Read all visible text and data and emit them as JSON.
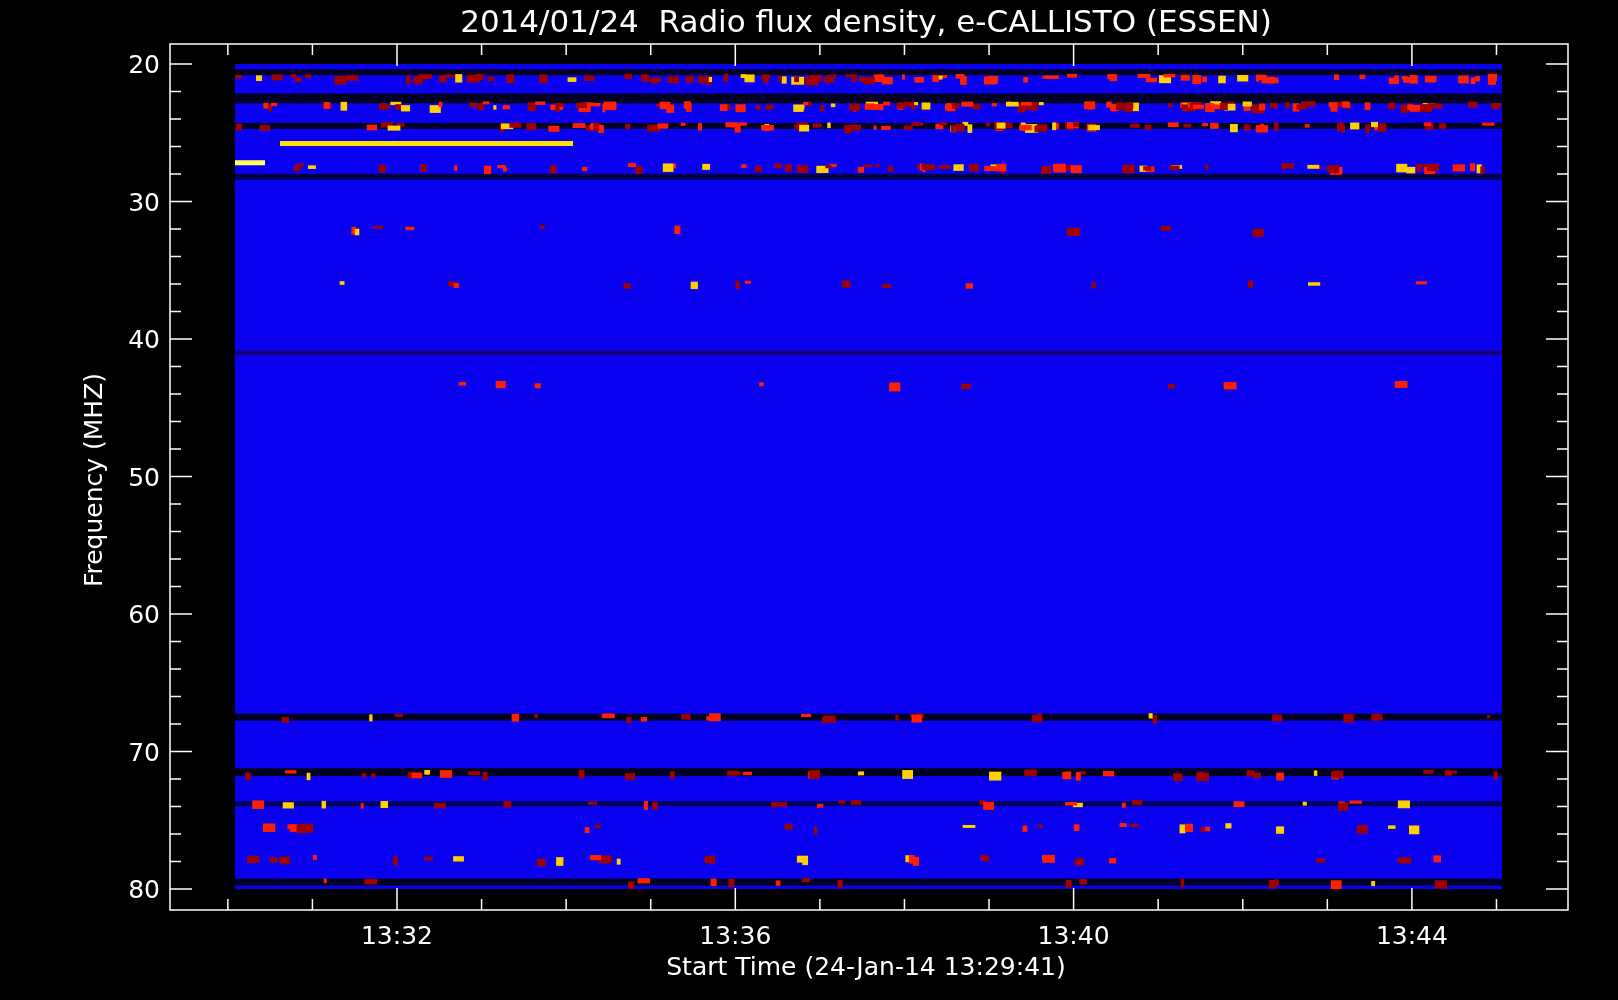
{
  "title": "2014/01/24  Radio flux density, e-CALLISTO (ESSEN)",
  "y_axis": {
    "label": "Frequency (MHZ)",
    "ticks": [
      "20",
      "30",
      "40",
      "50",
      "60",
      "70",
      "80"
    ]
  },
  "x_axis": {
    "label": "Start Time (24-Jan-14 13:29:41)",
    "ticks": [
      "13:32",
      "13:36",
      "13:40",
      "13:44"
    ]
  }
}
